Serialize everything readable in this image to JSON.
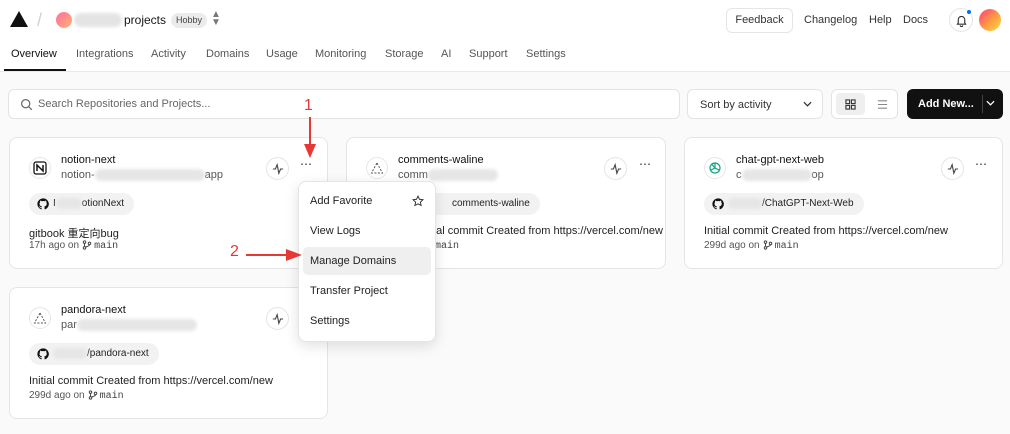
{
  "header": {
    "team_label": "projects",
    "plan_badge": "Hobby",
    "feedback_label": "Feedback",
    "links": [
      "Changelog",
      "Help",
      "Docs"
    ]
  },
  "tabs": [
    "Overview",
    "Integrations",
    "Activity",
    "Domains",
    "Usage",
    "Monitoring",
    "Storage",
    "AI",
    "Support",
    "Settings"
  ],
  "toolbar": {
    "search_placeholder": "Search Repositories and Projects...",
    "sort_label": "Sort by activity",
    "add_new_label": "Add New..."
  },
  "projects": [
    {
      "name": "notion-next",
      "url_prefix": "notion-",
      "url_suffix": "app",
      "repo_suffix": "otionNext",
      "commit_message": "gitbook 重定向bug",
      "time": "17h ago on",
      "branch": "main"
    },
    {
      "name": "comments-waline",
      "url_prefix": "comm",
      "url_suffix": "",
      "repo_suffix": "comments-waline",
      "commit_message": "Initial commit Created from https://vercel.com/new",
      "time": "",
      "branch": "main"
    },
    {
      "name": "chat-gpt-next-web",
      "url_prefix": "c",
      "url_suffix": "op",
      "repo_suffix": "/ChatGPT-Next-Web",
      "commit_message": "Initial commit Created from https://vercel.com/new",
      "time": "299d ago on",
      "branch": "main"
    },
    {
      "name": "pandora-next",
      "url_prefix": "par",
      "url_suffix": "",
      "repo_suffix": "/pandora-next",
      "commit_message": "Initial commit Created from https://vercel.com/new",
      "time": "299d ago on",
      "branch": "main"
    }
  ],
  "context_menu": {
    "items": [
      "Add Favorite",
      "View Logs",
      "Manage Domains",
      "Transfer Project",
      "Settings"
    ]
  },
  "annotations": {
    "step1": "1",
    "step2": "2",
    "color": "#e53935"
  }
}
